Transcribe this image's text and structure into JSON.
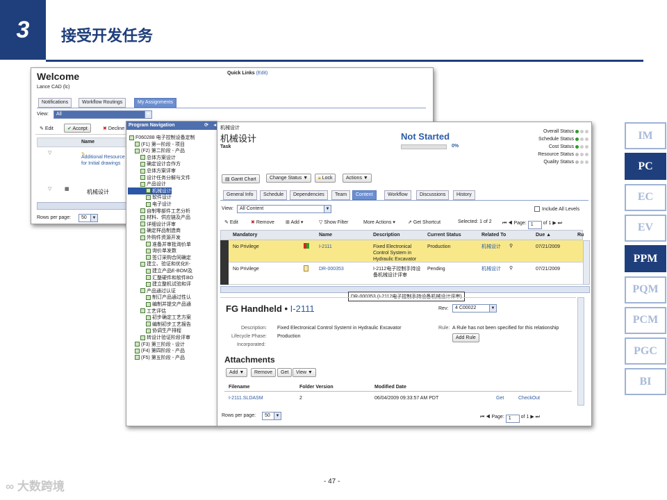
{
  "slide": {
    "number": "3",
    "title": "接受开发任务",
    "page_number": "- 47 -",
    "watermark": "大数跨境"
  },
  "side_tabs": [
    {
      "label": "IM",
      "active": false
    },
    {
      "label": "PC",
      "active": true
    },
    {
      "label": "EC",
      "active": false
    },
    {
      "label": "EV",
      "active": false
    },
    {
      "label": "PPM",
      "active": true
    },
    {
      "label": "PQM",
      "active": false
    },
    {
      "label": "PCM",
      "active": false
    },
    {
      "label": "PGC",
      "active": false
    },
    {
      "label": "BI",
      "active": false
    }
  ],
  "welcome": {
    "title": "Welcome",
    "user": "Lance CAD (lc)",
    "quick_links": "Quick Links",
    "edit_link": "(Edit)",
    "tabs": [
      "Notifications",
      "Workflow Routings",
      "My Assignments"
    ],
    "view_label": "View:",
    "view_value": "All",
    "actions": [
      "Edit",
      "Accept",
      "Decline"
    ],
    "col_name": "Name",
    "row1": "Additional Resource for Initial drawings",
    "row2": "机械设计",
    "rows_per_page_label": "Rows per page:",
    "rows_per_page": "50"
  },
  "nav": {
    "title": "Program Navigation",
    "items": [
      "F060288 电子控制设备定制",
      "(F1) 第一阶段 - 项目",
      "(F2) 第二阶段 - 产品",
      "总体方案设计",
      "确定设计合作方",
      "总体方案评审",
      "设计任务分解与文件",
      "产品设计",
      "机械设计",
      "软件设计",
      "电子设计",
      "自制零部件工艺分析",
      "材料、供应链及产品",
      "详细设计评审",
      "确定样品制造商",
      "外购件资源开发",
      "准备并审批询价单",
      "询价单发数",
      "签订采购合同确定",
      "建立、验证和优化E-",
      "建立产品E-BOM及",
      "汇整硬件和软件BO",
      "建立整机试验和评",
      "产品通过认证",
      "制订产品通过性认",
      "编制并提交产品通",
      "工艺评估",
      "初步确定工艺方案",
      "编制初步工艺报告",
      "协调生产排程",
      "转设计验证阶段评审",
      "(F3) 第三阶段 - 设计",
      "(F4) 第四阶段 - 产品",
      "(F5) 第五阶段 - 产品"
    ]
  },
  "task": {
    "path": "机械设计",
    "name": "机械设计",
    "type": "Task",
    "status": "Not Started",
    "progress_percent": 0,
    "progress_label": "0%",
    "status_panel": [
      {
        "label": "Overall Status",
        "color": "#2e9a2e"
      },
      {
        "label": "Schedule Status",
        "color": "#2e9a2e"
      },
      {
        "label": "Cost Status",
        "color": "#2e9a2e"
      },
      {
        "label": "Resource Status",
        "color": "#bbbbbb"
      },
      {
        "label": "Quality Status",
        "color": "#bbbbbb"
      }
    ],
    "buttons": [
      "Gantt Chart",
      "Change Status",
      "Lock",
      "Actions"
    ],
    "tabs": [
      "General Info",
      "Schedule",
      "Dependencies",
      "Team",
      "Content",
      "Workflow",
      "Discussions",
      "History"
    ],
    "view_label": "View:",
    "view_value": "All Content",
    "include_all_levels": "Include All Levels",
    "toolbar": [
      "Edit",
      "Remove",
      "Add",
      "Show Filter",
      "More Actions",
      "Get Shortcut"
    ],
    "selected": "Selected:",
    "selected_count": "1 of 2",
    "page_label": "Page:",
    "page_value": "1",
    "of_pages": "of 1",
    "columns": [
      "Mandatory",
      "Name",
      "Description",
      "Current Status",
      "Related To",
      "Due"
    ],
    "rows": [
      {
        "mandatory": "No Privilege",
        "name": "I-2111",
        "description": "Fixed Electronical Control System in Hydraulic Excavator",
        "status": "Production",
        "related": "机械设计",
        "due": "07/21/2009"
      },
      {
        "mandatory": "No Privilege",
        "name": "DR-000353",
        "description": "I-2112电子控制手持设备机械设计评审",
        "status": "Pending",
        "related": "机械设计",
        "due": "07/21/2009"
      }
    ],
    "tooltip": "DR-000353 (I-2112电子控制手持设备机械设计评审)",
    "detail": {
      "heading": "FG Handheld • ",
      "id": "I-2111",
      "rev_label": "Rev:",
      "rev_value": "4 C00022",
      "description_label": "Description:",
      "description_value": "Fixed Electronical Control SystemI in Hydraulic Excavator",
      "lifecycle_label": "Lifecycle Phase:",
      "lifecycle_value": "Production",
      "incorporated_label": "Incorporated:",
      "rule_label": "Rule:",
      "rule_value": "A Rule has not been specified for this relationship",
      "add_rule": "Add Rule",
      "attachments": "Attachments",
      "att_buttons": [
        "Add",
        "Remove",
        "Get",
        "View"
      ],
      "att_columns": [
        "Filename",
        "Folder Version",
        "Modified Date"
      ],
      "att_row": {
        "filename": "I-2111.SLDASM",
        "version": "2",
        "date": "06/04/2009 09:33:57 AM PDT",
        "get": "Get",
        "checkout": "CheckOut"
      }
    },
    "rows_per_page_label": "Rows per page:",
    "rows_per_page": "50"
  }
}
